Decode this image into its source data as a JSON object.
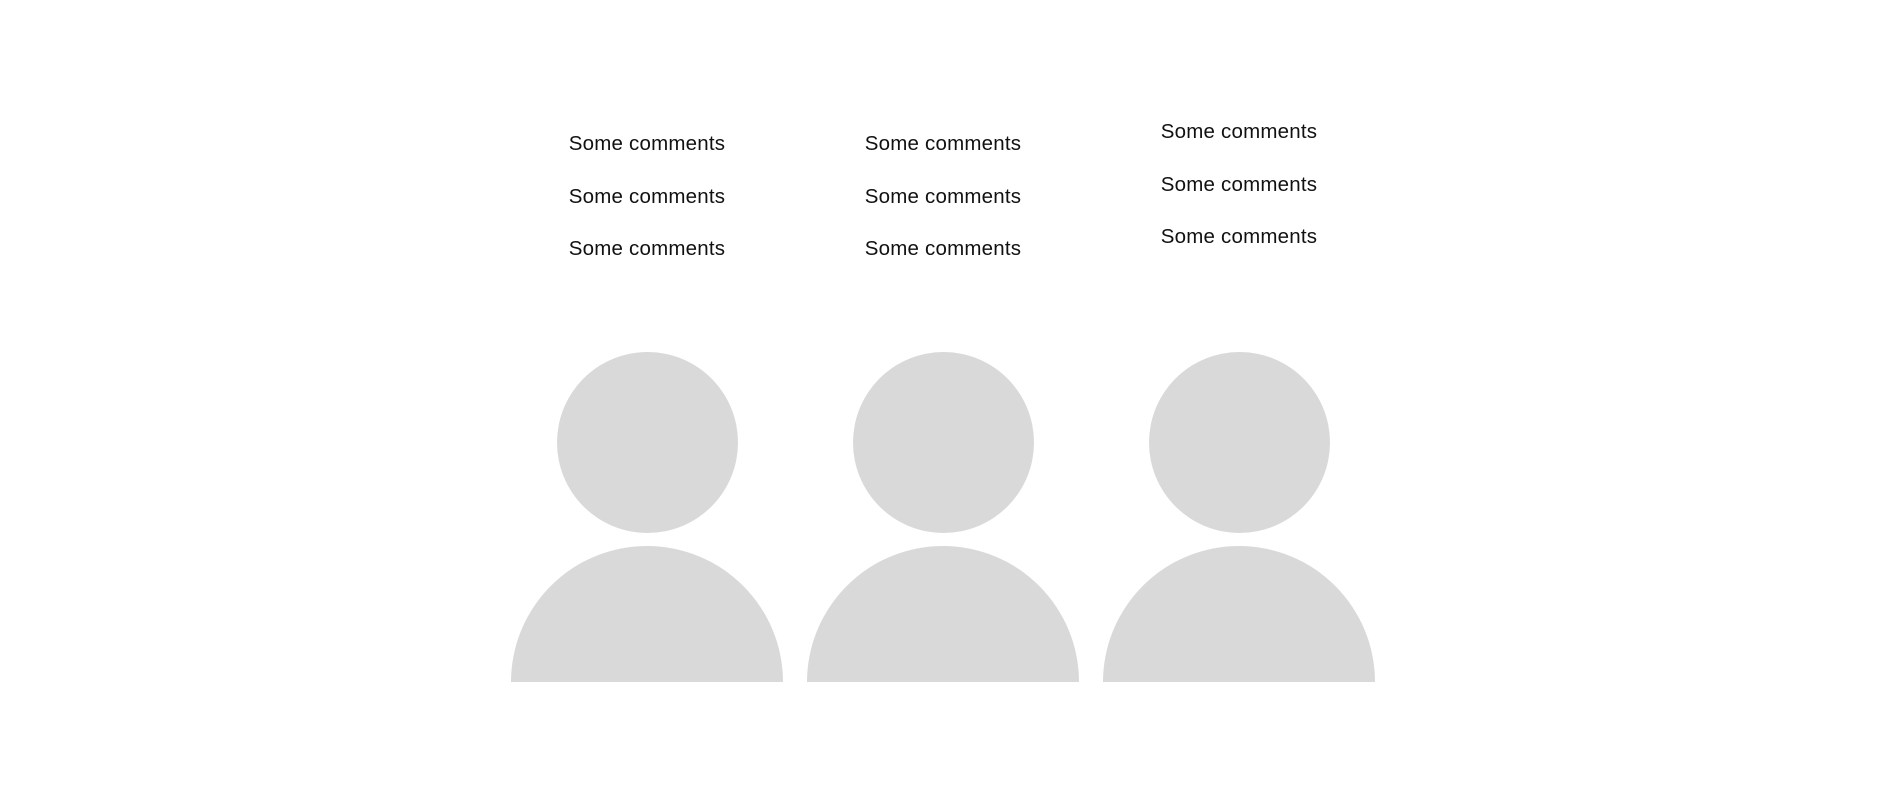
{
  "colors": {
    "background": "#ffffff",
    "text": "#111111",
    "avatar_placeholder": "#d9d9d9"
  },
  "columns": [
    {
      "comments": [
        "Some comments",
        "Some comments",
        "Some comments"
      ],
      "avatar_icon": "person-silhouette-icon"
    },
    {
      "comments": [
        "Some comments",
        "Some comments",
        "Some comments"
      ],
      "avatar_icon": "person-silhouette-icon"
    },
    {
      "comments": [
        "Some comments",
        "Some comments",
        "Some comments"
      ],
      "avatar_icon": "person-silhouette-icon"
    }
  ]
}
